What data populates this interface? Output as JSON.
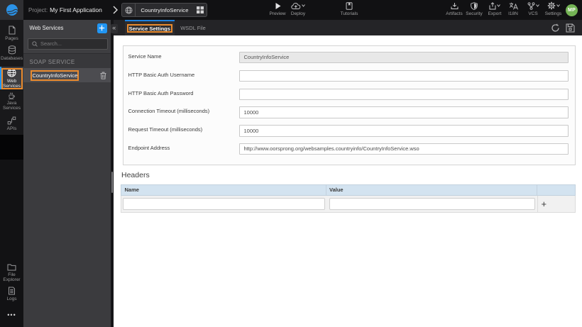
{
  "topbar": {
    "project_label": "Project:",
    "project_name": "My First Application",
    "doc_tab": "CountryInfoService",
    "preview": "Preview",
    "deploy": "Deploy",
    "tutorials": "Tutorials",
    "artifacts": "Artifacts",
    "security": "Security",
    "export": "Export",
    "i18n": "I18N",
    "vcs": "VCS",
    "settings": "Settings",
    "avatar_initials": "MP"
  },
  "sidebar": {
    "items": [
      {
        "id": "pages",
        "label": "Pages"
      },
      {
        "id": "databases",
        "label": "Databases"
      },
      {
        "id": "web-services",
        "label": "Web Services",
        "active": true
      },
      {
        "id": "java-services",
        "label": "Java Services"
      },
      {
        "id": "apis",
        "label": "APIs"
      },
      {
        "id": "file-explorer",
        "label": "File Explorer"
      },
      {
        "id": "logs",
        "label": "Logs"
      }
    ],
    "more": "•••"
  },
  "panel": {
    "title": "Web Services",
    "search_placeholder": "Search...",
    "section_label": "SOAP SERVICE",
    "service_name": "CountryInfoService",
    "collapse_glyph": "«"
  },
  "main": {
    "tabs": {
      "active": "Service Settings",
      "inactive": "WSDL File"
    },
    "form": {
      "fields": [
        {
          "label": "Service Name",
          "value": "CountryInfoService",
          "disabled": true
        },
        {
          "label": "HTTP Basic Auth Username",
          "value": ""
        },
        {
          "label": "HTTP Basic Auth Password",
          "value": ""
        },
        {
          "label": "Connection Timeout (milliseconds)",
          "value": "10000"
        },
        {
          "label": "Request Timeout (milliseconds)",
          "value": "10000"
        },
        {
          "label": "Endpoint Address",
          "value": "http://www.oorsprong.org/websamples.countryinfo/CountryInfoService.wso"
        }
      ]
    },
    "headers_section": {
      "title": "Headers",
      "col_name": "Name",
      "col_value": "Value",
      "add_label": "+"
    }
  },
  "colors": {
    "accent_blue": "#2196f3",
    "annotation_orange": "#ea8b2e",
    "avatar_green": "#74b355",
    "table_header_blue": "#d3e3f0"
  }
}
